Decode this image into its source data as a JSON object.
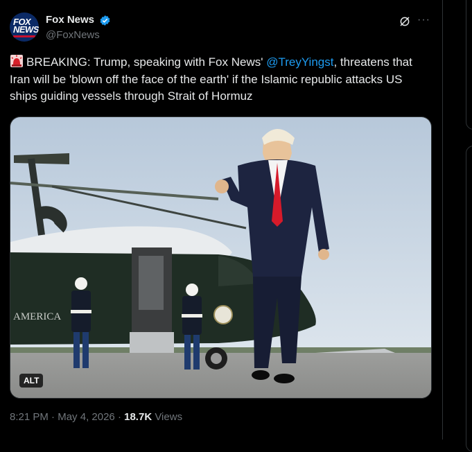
{
  "tweet": {
    "author_name": "Fox News",
    "author_handle": "@FoxNews",
    "avatar_text_line1": "FOX",
    "avatar_text_line2": "NEWS",
    "text_part1": "BREAKING: Trump, speaking with Fox News' ",
    "mention": "@TreyYingst",
    "text_part2": ", threatens that Iran will be 'blown off the face of the earth' if the Islamic republic attacks US ships guiding vessels through Strait of Hormuz",
    "alt_badge": "ALT",
    "time": "8:21 PM",
    "separator": "·",
    "date": "May 4, 2026",
    "views_count": "18.7K",
    "views_label": "Views",
    "more_label": "···"
  },
  "colors": {
    "accent": "#1d9bf0",
    "muted": "#71767b",
    "text": "#e7e9ea",
    "background": "#000000"
  },
  "icons": {
    "verified": "verified-badge-icon",
    "grok": "grok-icon",
    "more": "more-icon",
    "alarm": "rotating-light-icon"
  }
}
